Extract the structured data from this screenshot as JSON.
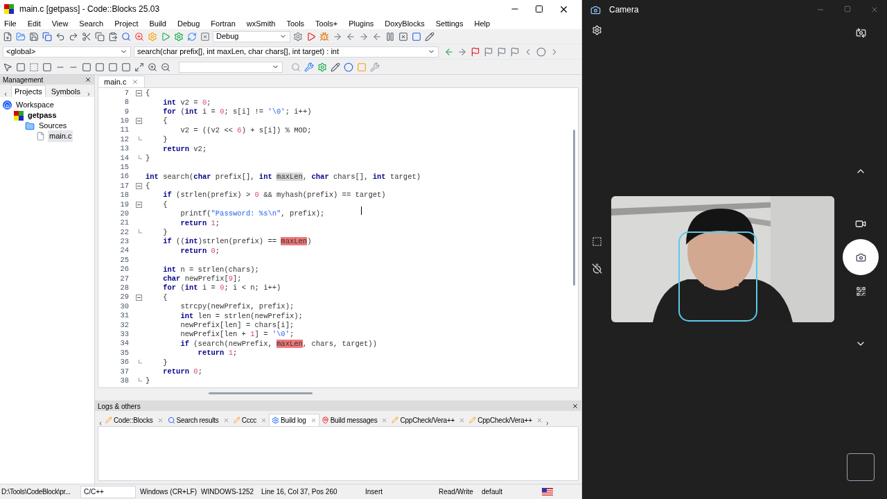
{
  "window": {
    "title": "main.c [getpass] - Code::Blocks 25.03"
  },
  "menu": [
    "File",
    "Edit",
    "View",
    "Search",
    "Project",
    "Build",
    "Debug",
    "Fortran",
    "wxSmith",
    "Tools",
    "Tools+",
    "Plugins",
    "DoxyBlocks",
    "Settings",
    "Help"
  ],
  "toolbar": {
    "build_target": "Debug"
  },
  "code_nav": {
    "scope": "<global>",
    "function": "search(char prefix[], int maxLen, char chars[], int target) : int"
  },
  "management": {
    "title": "Management",
    "tabs": [
      {
        "label": "Projects",
        "selected": true
      },
      {
        "label": "Symbols",
        "selected": false
      }
    ],
    "tree": [
      {
        "label": "Workspace",
        "kind": "workspace",
        "selected": false,
        "children": [
          {
            "label": "getpass",
            "kind": "project",
            "selected": false,
            "children": [
              {
                "label": "Sources",
                "kind": "folder",
                "selected": false,
                "children": [
                  {
                    "label": "main.c",
                    "kind": "file",
                    "selected": true
                  }
                ]
              }
            ]
          }
        ]
      }
    ]
  },
  "editor": {
    "tabs": [
      {
        "label": "main.c",
        "selected": true
      }
    ],
    "lines": [
      {
        "number": "7",
        "block_start": true,
        "block_end": false,
        "tokens": [
          {
            "kind": "plain",
            "text": "{"
          }
        ]
      },
      {
        "number": "8",
        "block_start": false,
        "block_end": false,
        "tokens": [
          {
            "kind": "keyword",
            "text": "    int"
          },
          {
            "kind": "plain",
            "text": " v2 = "
          },
          {
            "kind": "number",
            "text": "0"
          },
          {
            "kind": "plain",
            "text": ";"
          }
        ]
      },
      {
        "number": "9",
        "block_start": false,
        "block_end": false,
        "tokens": [
          {
            "kind": "keyword",
            "text": "    for"
          },
          {
            "kind": "plain",
            "text": " ("
          },
          {
            "kind": "keyword",
            "text": "int"
          },
          {
            "kind": "plain",
            "text": " i = "
          },
          {
            "kind": "number",
            "text": "0"
          },
          {
            "kind": "plain",
            "text": "; s[i] != "
          },
          {
            "kind": "string",
            "text": "'\\0'"
          },
          {
            "kind": "plain",
            "text": "; i++)"
          }
        ]
      },
      {
        "number": "10",
        "block_start": true,
        "block_end": false,
        "tokens": [
          {
            "kind": "plain",
            "text": "    {"
          }
        ]
      },
      {
        "number": "11",
        "block_start": false,
        "block_end": false,
        "tokens": [
          {
            "kind": "plain",
            "text": "        v2 = ((v2 << "
          },
          {
            "kind": "number",
            "text": "6"
          },
          {
            "kind": "plain",
            "text": ") + s[i]) % MOD;"
          }
        ]
      },
      {
        "number": "12",
        "block_start": false,
        "block_end": true,
        "tokens": [
          {
            "kind": "plain",
            "text": "    }"
          }
        ]
      },
      {
        "number": "13",
        "block_start": false,
        "block_end": false,
        "tokens": [
          {
            "kind": "keyword",
            "text": "    return"
          },
          {
            "kind": "plain",
            "text": " v2;"
          }
        ]
      },
      {
        "number": "14",
        "block_start": false,
        "block_end": true,
        "tokens": [
          {
            "kind": "plain",
            "text": "}"
          }
        ]
      },
      {
        "number": "15",
        "block_start": false,
        "block_end": false
      },
      {
        "number": "16",
        "block_start": false,
        "block_end": false,
        "tokens": [
          {
            "kind": "keyword",
            "text": "int"
          },
          {
            "kind": "plain",
            "text": " search("
          },
          {
            "kind": "keyword",
            "text": "char"
          },
          {
            "kind": "plain",
            "text": " prefix[], "
          },
          {
            "kind": "keyword",
            "text": "int "
          },
          {
            "kind": "selected",
            "text": "maxLen"
          },
          {
            "kind": "plain",
            "text": ", "
          },
          {
            "kind": "keyword",
            "text": "char"
          },
          {
            "kind": "plain",
            "text": " chars[], "
          },
          {
            "kind": "keyword",
            "text": "int"
          },
          {
            "kind": "plain",
            "text": " target)"
          }
        ]
      },
      {
        "number": "17",
        "block_start": true,
        "block_end": false,
        "tokens": [
          {
            "kind": "plain",
            "text": "{"
          }
        ]
      },
      {
        "number": "18",
        "block_start": false,
        "block_end": false,
        "tokens": [
          {
            "kind": "keyword",
            "text": "    if"
          },
          {
            "kind": "plain",
            "text": " (strlen(prefix) > "
          },
          {
            "kind": "number",
            "text": "0"
          },
          {
            "kind": "plain",
            "text": " && myhash(prefix) == target)"
          }
        ]
      },
      {
        "number": "19",
        "block_start": true,
        "block_end": false,
        "tokens": [
          {
            "kind": "plain",
            "text": "    {"
          }
        ]
      },
      {
        "number": "20",
        "block_start": false,
        "block_end": false,
        "tokens": [
          {
            "kind": "plain",
            "text": "        printf("
          },
          {
            "kind": "string",
            "text": "\"Password: %s\\n\""
          },
          {
            "kind": "plain",
            "text": ", prefix);"
          }
        ]
      },
      {
        "number": "21",
        "block_start": false,
        "block_end": false,
        "tokens": [
          {
            "kind": "keyword",
            "text": "        return "
          },
          {
            "kind": "number",
            "text": "1"
          },
          {
            "kind": "plain",
            "text": ";"
          }
        ]
      },
      {
        "number": "22",
        "block_start": false,
        "block_end": true,
        "tokens": [
          {
            "kind": "plain",
            "text": "    }"
          }
        ]
      },
      {
        "number": "23",
        "block_start": false,
        "block_end": false,
        "tokens": [
          {
            "kind": "keyword",
            "text": "    if"
          },
          {
            "kind": "plain",
            "text": " (("
          },
          {
            "kind": "keyword",
            "text": "int"
          },
          {
            "kind": "plain",
            "text": ")strlen(prefix) == "
          },
          {
            "kind": "match",
            "text": "maxLen"
          },
          {
            "kind": "plain",
            "text": ")"
          }
        ]
      },
      {
        "number": "24",
        "block_start": false,
        "block_end": false,
        "tokens": [
          {
            "kind": "keyword",
            "text": "        return "
          },
          {
            "kind": "number",
            "text": "0"
          },
          {
            "kind": "plain",
            "text": ";"
          }
        ]
      },
      {
        "number": "25",
        "block_start": false,
        "block_end": false
      },
      {
        "number": "26",
        "block_start": false,
        "block_end": false,
        "tokens": [
          {
            "kind": "keyword",
            "text": "    int"
          },
          {
            "kind": "plain",
            "text": " n = strlen(chars);"
          }
        ]
      },
      {
        "number": "27",
        "block_start": false,
        "block_end": false,
        "tokens": [
          {
            "kind": "keyword",
            "text": "    char"
          },
          {
            "kind": "plain",
            "text": " newPrefix["
          },
          {
            "kind": "number",
            "text": "9"
          },
          {
            "kind": "plain",
            "text": "];"
          }
        ]
      },
      {
        "number": "28",
        "block_start": false,
        "block_end": false,
        "tokens": [
          {
            "kind": "keyword",
            "text": "    for"
          },
          {
            "kind": "plain",
            "text": " ("
          },
          {
            "kind": "keyword",
            "text": "int"
          },
          {
            "kind": "plain",
            "text": " i = "
          },
          {
            "kind": "number",
            "text": "0"
          },
          {
            "kind": "plain",
            "text": "; i < n; i++)"
          }
        ]
      },
      {
        "number": "29",
        "block_start": true,
        "block_end": false,
        "tokens": [
          {
            "kind": "plain",
            "text": "    {"
          }
        ]
      },
      {
        "number": "30",
        "block_start": false,
        "block_end": false,
        "tokens": [
          {
            "kind": "plain",
            "text": "        strcpy(newPrefix, prefix);"
          }
        ]
      },
      {
        "number": "31",
        "block_start": false,
        "block_end": false,
        "tokens": [
          {
            "kind": "keyword",
            "text": "        int"
          },
          {
            "kind": "plain",
            "text": " len = strlen(newPrefix);"
          }
        ]
      },
      {
        "number": "32",
        "block_start": false,
        "block_end": false,
        "tokens": [
          {
            "kind": "plain",
            "text": "        newPrefix[len] = chars[i];"
          }
        ]
      },
      {
        "number": "33",
        "block_start": false,
        "block_end": false,
        "tokens": [
          {
            "kind": "plain",
            "text": "        newPrefix[len + "
          },
          {
            "kind": "number",
            "text": "1"
          },
          {
            "kind": "plain",
            "text": "] = "
          },
          {
            "kind": "string",
            "text": "'\\0'"
          },
          {
            "kind": "plain",
            "text": ";"
          }
        ]
      },
      {
        "number": "34",
        "block_start": false,
        "block_end": false,
        "tokens": [
          {
            "kind": "keyword",
            "text": "        if"
          },
          {
            "kind": "plain",
            "text": " (search(newPrefix, "
          },
          {
            "kind": "match",
            "text": "maxLen"
          },
          {
            "kind": "plain",
            "text": ", chars, target))"
          }
        ]
      },
      {
        "number": "35",
        "block_start": false,
        "block_end": false,
        "tokens": [
          {
            "kind": "keyword",
            "text": "            return "
          },
          {
            "kind": "number",
            "text": "1"
          },
          {
            "kind": "plain",
            "text": ";"
          }
        ]
      },
      {
        "number": "36",
        "block_start": false,
        "block_end": true,
        "tokens": [
          {
            "kind": "plain",
            "text": "    }"
          }
        ]
      },
      {
        "number": "37",
        "block_start": false,
        "block_end": false,
        "tokens": [
          {
            "kind": "keyword",
            "text": "    return "
          },
          {
            "kind": "number",
            "text": "0"
          },
          {
            "kind": "plain",
            "text": ";"
          }
        ]
      },
      {
        "number": "38",
        "block_start": false,
        "block_end": true,
        "tokens": [
          {
            "kind": "plain",
            "text": "}"
          }
        ]
      }
    ]
  },
  "logs": {
    "title": "Logs & others",
    "tabs": [
      {
        "label": "Code::Blocks",
        "kind": "note",
        "selected": false
      },
      {
        "label": "Search results",
        "kind": "search",
        "selected": false
      },
      {
        "label": "Cccc",
        "kind": "note",
        "selected": false
      },
      {
        "label": "Build log",
        "kind": "gear",
        "selected": true
      },
      {
        "label": "Build messages",
        "kind": "pin",
        "selected": false
      },
      {
        "label": "CppCheck/Vera++",
        "kind": "note",
        "selected": false
      },
      {
        "label": "CppCheck/Vera++",
        "kind": "note",
        "selected": false
      }
    ]
  },
  "status_bar": {
    "path": "D:\\Tools\\CodeBlock\\pr...",
    "language": "C/C++",
    "line_endings": "Windows (CR+LF)",
    "encoding": "WINDOWS-1252",
    "position": "Line 16, Col 37, Pos 260",
    "mode": "Insert",
    "access": "Read/Write",
    "profile": "default"
  },
  "camera": {
    "title": "Camera"
  }
}
